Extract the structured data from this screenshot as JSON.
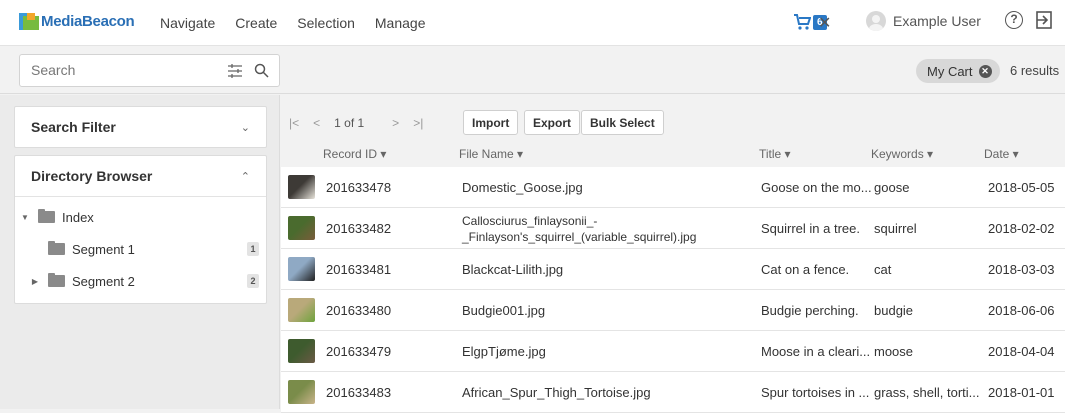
{
  "brand": {
    "name": "MediaBeacon"
  },
  "nav": [
    "Navigate",
    "Create",
    "Selection",
    "Manage"
  ],
  "cart": {
    "count": "6"
  },
  "user": {
    "name": "Example User"
  },
  "search": {
    "placeholder": "Search"
  },
  "filter_chip": {
    "label": "My Cart"
  },
  "results_text": "6 results",
  "sidebar": {
    "search_filter": "Search Filter",
    "directory_browser": "Directory Browser",
    "tree": [
      {
        "label": "Index",
        "count": ""
      },
      {
        "label": "Segment 1",
        "count": "1"
      },
      {
        "label": "Segment 2",
        "count": "2"
      }
    ]
  },
  "pager": {
    "text": "1 of 1"
  },
  "actions": {
    "import": "Import",
    "export": "Export",
    "bulk_select": "Bulk Select"
  },
  "columns": [
    "Record ID ▾",
    "File Name ▾",
    "Title ▾",
    "Keywords ▾",
    "Date ▾"
  ],
  "rows": [
    {
      "id": "201633478",
      "file": "Domestic_Goose.jpg",
      "file2": "",
      "title": "Goose on the mo...",
      "keywords": "goose",
      "date": "2018-05-05",
      "thumb": [
        "#3d3a36",
        "#e8e4dc"
      ]
    },
    {
      "id": "201633482",
      "file": "Callosciurus_finlaysonii_-",
      "file2": "_Finlayson's_squirrel_(variable_squirrel).jpg",
      "title": "Squirrel in a tree.",
      "keywords": "squirrel",
      "date": "2018-02-02",
      "thumb": [
        "#4a6b2e",
        "#7a5c3a"
      ]
    },
    {
      "id": "201633481",
      "file": "Blackcat-Lilith.jpg",
      "file2": "",
      "title": "Cat on a fence.",
      "keywords": "cat",
      "date": "2018-03-03",
      "thumb": [
        "#8fa9c4",
        "#1f1f1f"
      ]
    },
    {
      "id": "201633480",
      "file": "Budgie001.jpg",
      "file2": "",
      "title": "Budgie perching.",
      "keywords": "budgie",
      "date": "2018-06-06",
      "thumb": [
        "#b9a97a",
        "#6ea33c"
      ]
    },
    {
      "id": "201633479",
      "file": "ElgpTjøme.jpg",
      "file2": "",
      "title": "Moose in a cleari...",
      "keywords": "moose",
      "date": "2018-04-04",
      "thumb": [
        "#3e5b2e",
        "#6b5a45"
      ]
    },
    {
      "id": "201633483",
      "file": "African_Spur_Thigh_Tortoise.jpg",
      "file2": "",
      "title": "Spur tortoises in ...",
      "keywords": "grass, shell, torti...",
      "date": "2018-01-01",
      "thumb": [
        "#7a8c4a",
        "#c9b48a"
      ]
    }
  ]
}
